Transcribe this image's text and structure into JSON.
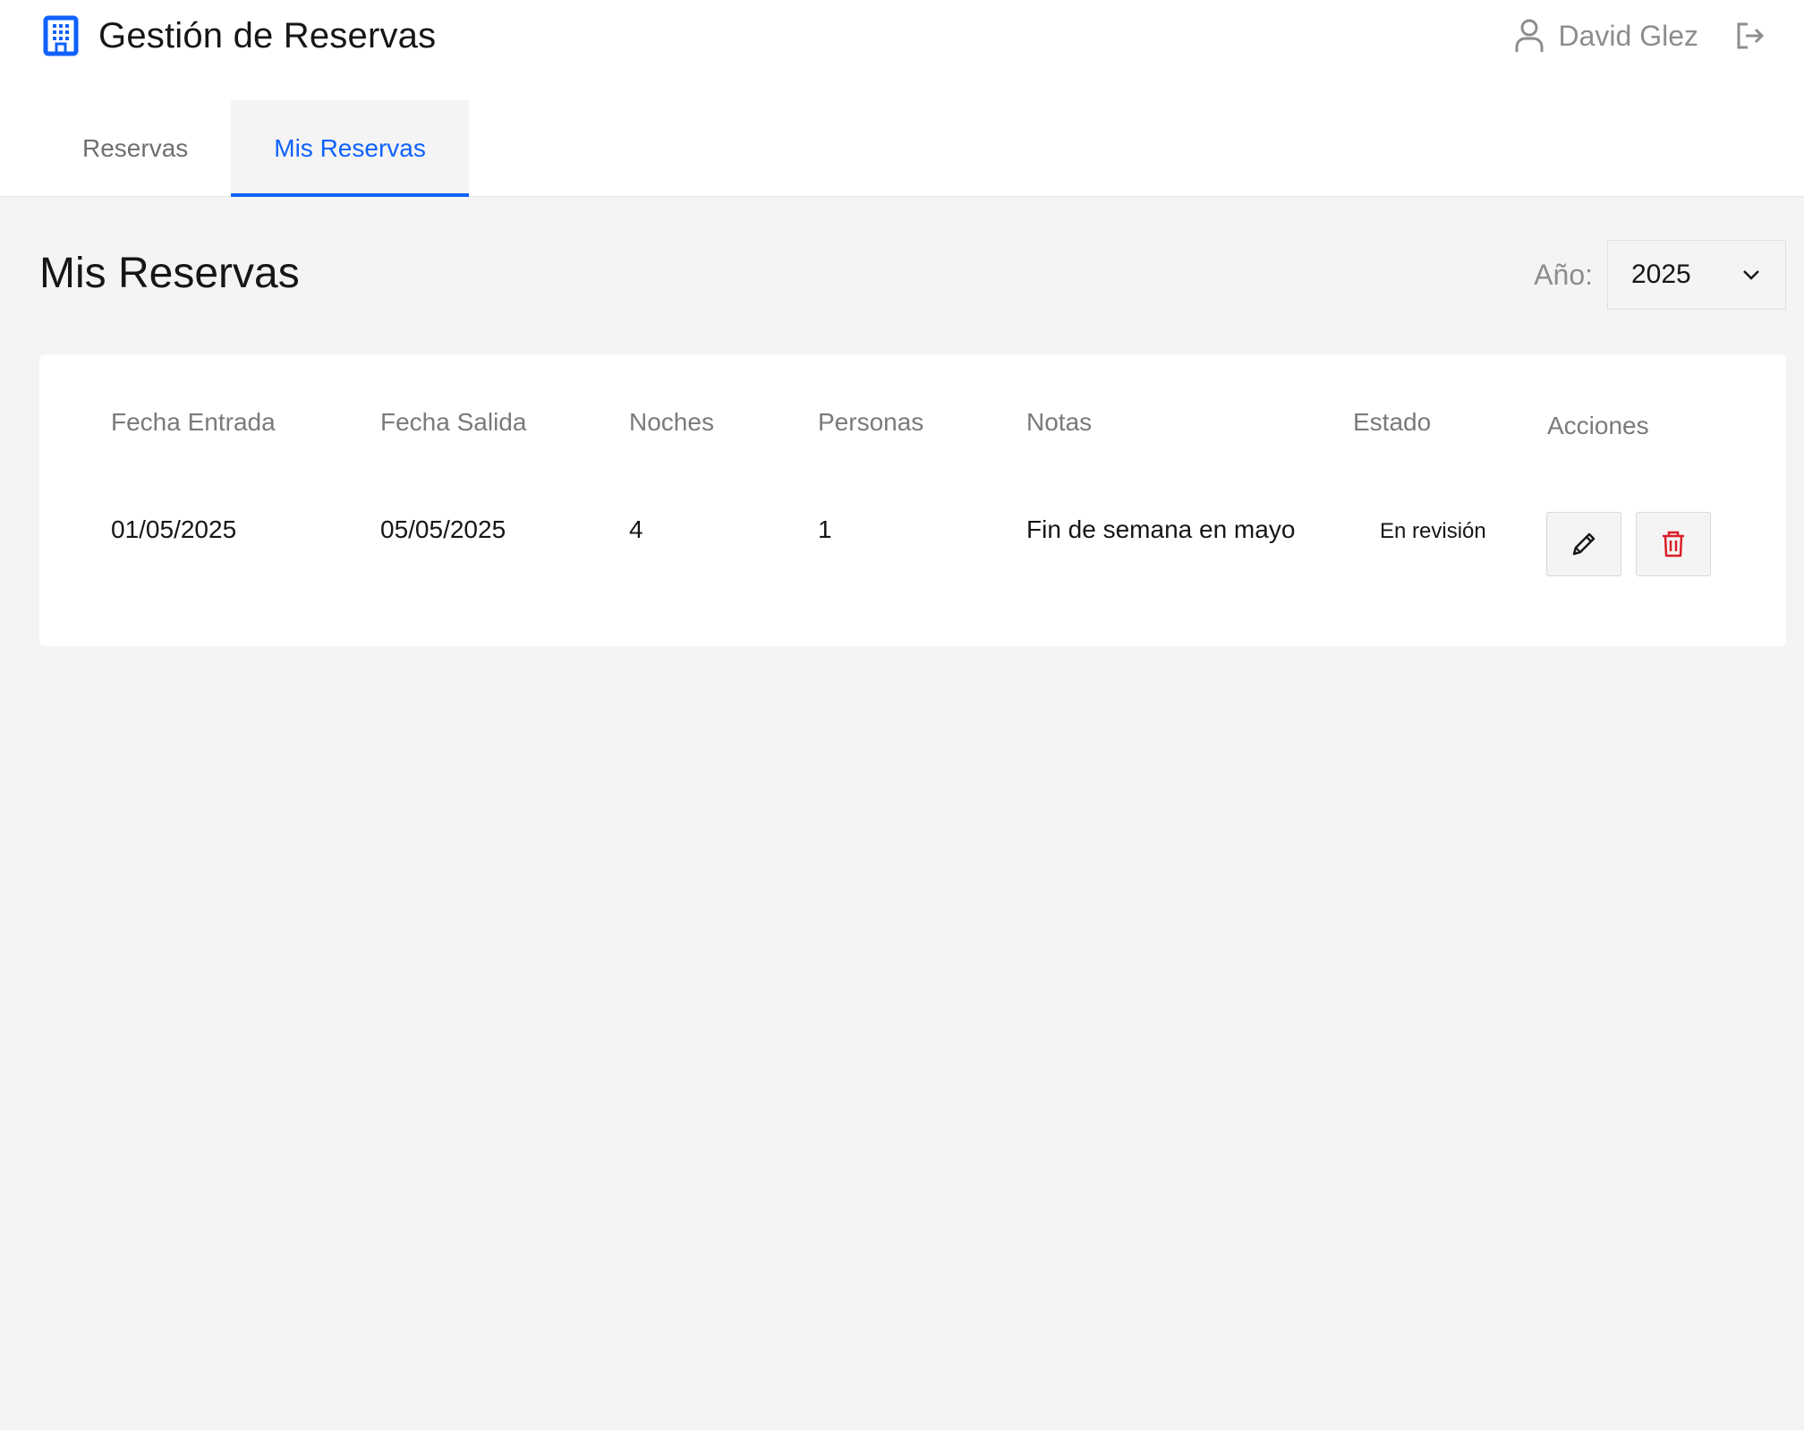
{
  "header": {
    "brand_icon": "building-icon",
    "app_title": "Gestión de Reservas",
    "user_icon": "user-icon",
    "user_name": "David Glez",
    "logout_icon": "logout-icon"
  },
  "tabs": [
    {
      "label": "Reservas",
      "active": false
    },
    {
      "label": "Mis Reservas",
      "active": true
    }
  ],
  "page": {
    "title": "Mis Reservas",
    "year_filter": {
      "label": "Año:",
      "selected": "2025"
    }
  },
  "table": {
    "columns": [
      "Fecha Entrada",
      "Fecha Salida",
      "Noches",
      "Personas",
      "Notas",
      "Estado",
      "Acciones"
    ],
    "rows": [
      {
        "fecha_entrada": "01/05/2025",
        "fecha_salida": "05/05/2025",
        "noches": "4",
        "personas": "1",
        "notas": "Fin de semana en mayo",
        "estado": "En revisión",
        "actions": [
          "edit-icon",
          "trash-icon"
        ]
      }
    ]
  },
  "colors": {
    "accent": "#0f62fe",
    "delete": "#da1e28",
    "page_background": "#f4f4f4",
    "surface": "#ffffff"
  }
}
